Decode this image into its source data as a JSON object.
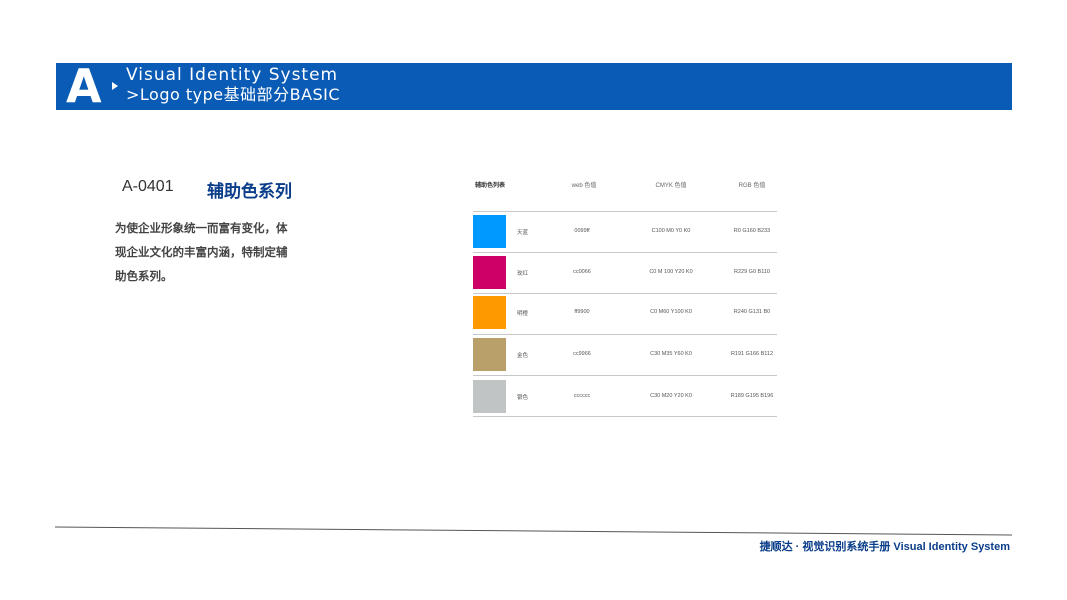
{
  "header": {
    "letter": "A",
    "line1": "Visual Identity System",
    "line2": ">Logo type基础部分BASIC"
  },
  "section": {
    "code": "A-0401",
    "title": "辅助色系列",
    "description": "为使企业形象统一而富有变化，体现企业文化的丰富内涵，特制定辅助色系列。"
  },
  "table": {
    "headers": [
      "辅助色列表",
      "web 色值",
      "CMYK 色值",
      "RGB 色值"
    ],
    "rows": [
      {
        "color": "#0099ff",
        "name": "天蓝",
        "web": "0099ff",
        "cmyk": "C100 M0 Y0 K0",
        "rgb": "R0 G160 B233"
      },
      {
        "color": "#cc0066",
        "name": "玫红",
        "web": "cc0066",
        "cmyk": "C0 M 100 Y20 K0",
        "rgb": "R229 G0 B110"
      },
      {
        "color": "#ff9900",
        "name": "明橙",
        "web": "ff9900",
        "cmyk": "C0 M60 Y100 K0",
        "rgb": "R240 G131 B0"
      },
      {
        "color": "#b9a06b",
        "name": "金色",
        "web": "cc9966",
        "cmyk": "C30 M35 Y60 K0",
        "rgb": "R191 G166 B112"
      },
      {
        "color": "#c0c4c4",
        "name": "银色",
        "web": "cccccc",
        "cmyk": "C30 M20 Y20 K0",
        "rgb": "R189 G195 B196"
      }
    ]
  },
  "footer": {
    "text": "捷顺达 · 视觉识别系统手册 Visual Identity System"
  },
  "colors": {
    "brand_blue": "#0a5bb5",
    "title_blue": "#0a3d8a"
  }
}
